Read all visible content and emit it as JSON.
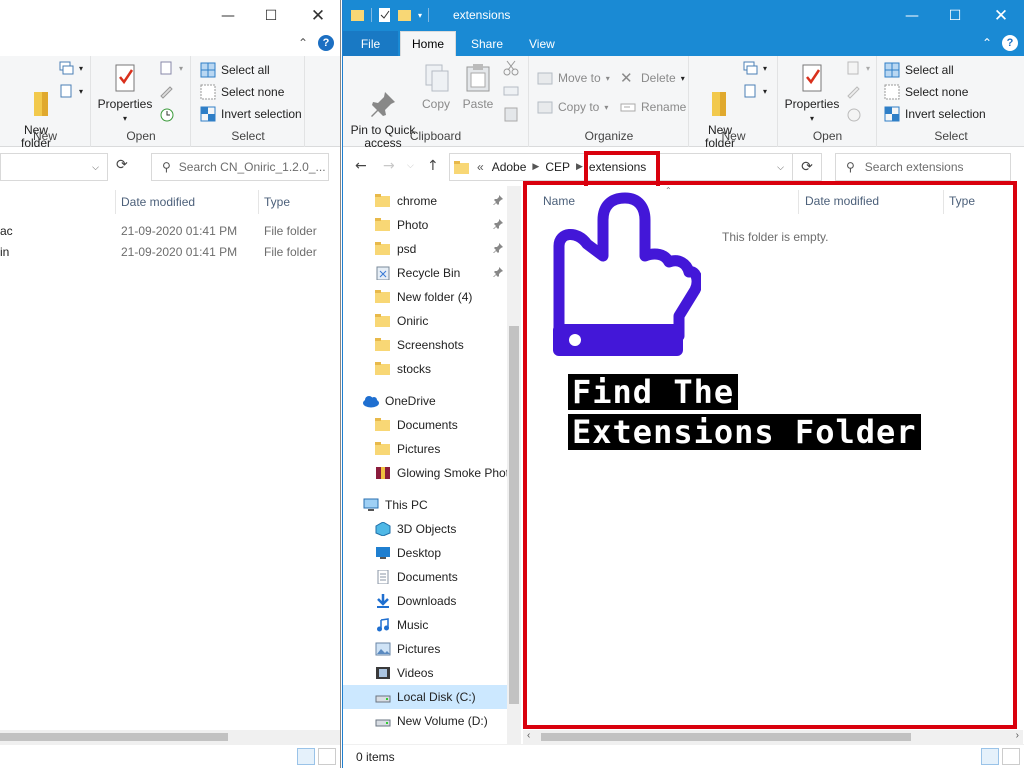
{
  "left_window": {
    "ribbon": {
      "new_folder": "New\nfolder",
      "new_group": "New",
      "properties": "Properties",
      "open_group": "Open",
      "select_all": "Select all",
      "select_none": "Select none",
      "invert_selection": "Invert selection",
      "select_group": "Select"
    },
    "search_placeholder": "Search CN_Oniric_1.2.0_...",
    "columns": {
      "date_modified": "Date modified",
      "type": "Type"
    },
    "rows": [
      {
        "name": "ac",
        "date": "21-09-2020 01:41 PM",
        "type": "File folder"
      },
      {
        "name": "in",
        "date": "21-09-2020 01:41 PM",
        "type": "File folder"
      }
    ]
  },
  "right_window": {
    "title": "extensions",
    "tabs": {
      "file": "File",
      "home": "Home",
      "share": "Share",
      "view": "View"
    },
    "ribbon": {
      "pin_quick_access": "Pin to Quick\naccess",
      "copy": "Copy",
      "paste": "Paste",
      "clipboard_group": "Clipboard",
      "move_to": "Move to",
      "copy_to": "Copy to",
      "delete": "Delete",
      "rename": "Rename",
      "organize_group": "Organize",
      "new_folder": "New\nfolder",
      "new_group": "New",
      "properties": "Properties",
      "open_group": "Open",
      "select_all": "Select all",
      "select_none": "Select none",
      "invert_selection": "Invert selection",
      "select_group": "Select"
    },
    "breadcrumb": {
      "overflow": "«",
      "items": [
        "Adobe",
        "CEP",
        "extensions"
      ]
    },
    "search_placeholder": "Search extensions",
    "nav_items": [
      {
        "label": "chrome",
        "icon": "folder-icon",
        "pinned": true
      },
      {
        "label": "Photo",
        "icon": "folder-icon",
        "pinned": true
      },
      {
        "label": "psd",
        "icon": "folder-icon",
        "pinned": true
      },
      {
        "label": "Recycle Bin",
        "icon": "recycle-bin-icon",
        "pinned": true
      },
      {
        "label": "New folder (4)",
        "icon": "folder-icon",
        "pinned": false
      },
      {
        "label": "Oniric",
        "icon": "folder-icon",
        "pinned": false
      },
      {
        "label": "Screenshots",
        "icon": "folder-icon",
        "pinned": false
      },
      {
        "label": "stocks",
        "icon": "folder-icon",
        "pinned": false
      },
      {
        "label": "OneDrive",
        "icon": "onedrive-icon",
        "pinned": false
      },
      {
        "label": "Documents",
        "icon": "folder-icon",
        "pinned": false
      },
      {
        "label": "Pictures",
        "icon": "folder-icon",
        "pinned": false
      },
      {
        "label": "Glowing Smoke Phot",
        "icon": "archive-icon",
        "pinned": false
      },
      {
        "label": "This PC",
        "icon": "computer-icon",
        "pinned": false
      },
      {
        "label": "3D Objects",
        "icon": "cube-icon",
        "pinned": false
      },
      {
        "label": "Desktop",
        "icon": "desktop-icon",
        "pinned": false
      },
      {
        "label": "Documents",
        "icon": "document-icon",
        "pinned": false
      },
      {
        "label": "Downloads",
        "icon": "download-icon",
        "pinned": false
      },
      {
        "label": "Music",
        "icon": "music-icon",
        "pinned": false
      },
      {
        "label": "Pictures",
        "icon": "picture-icon",
        "pinned": false
      },
      {
        "label": "Videos",
        "icon": "video-icon",
        "pinned": false
      },
      {
        "label": "Local Disk (C:)",
        "icon": "drive-icon",
        "pinned": false,
        "selected": true
      },
      {
        "label": "New Volume (D:)",
        "icon": "drive-icon",
        "pinned": false
      }
    ],
    "columns": {
      "name": "Name",
      "date_modified": "Date modified",
      "type": "Type"
    },
    "empty_message": "This folder is empty.",
    "status": "0 items"
  },
  "overlay": {
    "caption_line1": "Find The",
    "caption_line2": "Extensions Folder",
    "accent_color": "#d9000d",
    "hand_color": "#4317d8"
  }
}
